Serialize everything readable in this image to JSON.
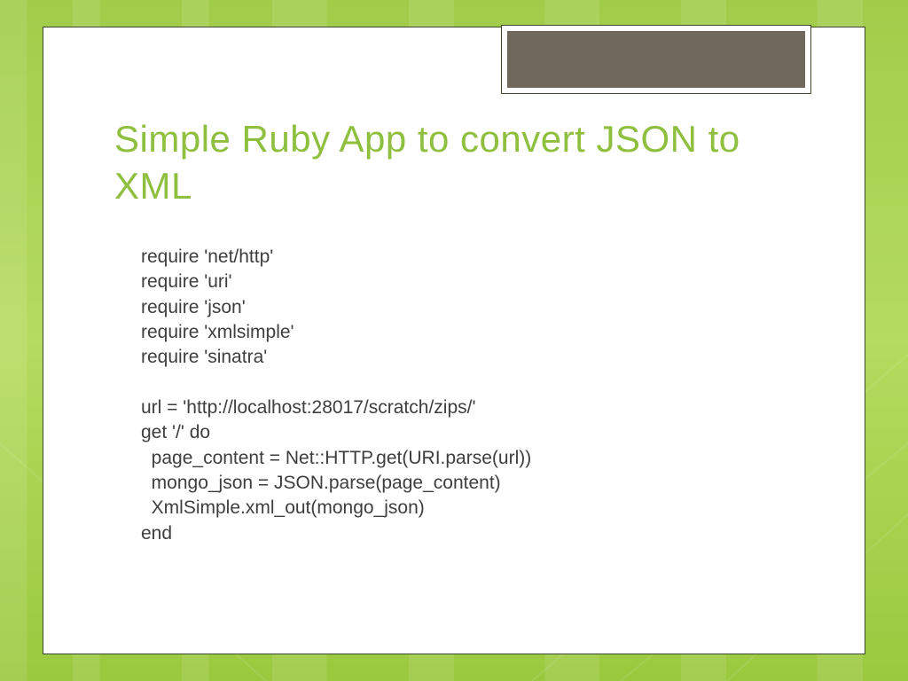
{
  "title": "Simple Ruby App to convert JSON to XML",
  "code": {
    "l1": "require 'net/http'",
    "l2": "require 'uri'",
    "l3": "require 'json'",
    "l4": "require 'xmlsimple'",
    "l5": "require 'sinatra'",
    "l6": "",
    "l7": "url = 'http://localhost:28017/scratch/zips/'",
    "l8": "get '/' do",
    "l9": "  page_content = Net::HTTP.get(URI.parse(url))",
    "l10": "  mongo_json = JSON.parse(page_content)",
    "l11": "  XmlSimple.xml_out(mongo_json)",
    "l12": "end"
  }
}
